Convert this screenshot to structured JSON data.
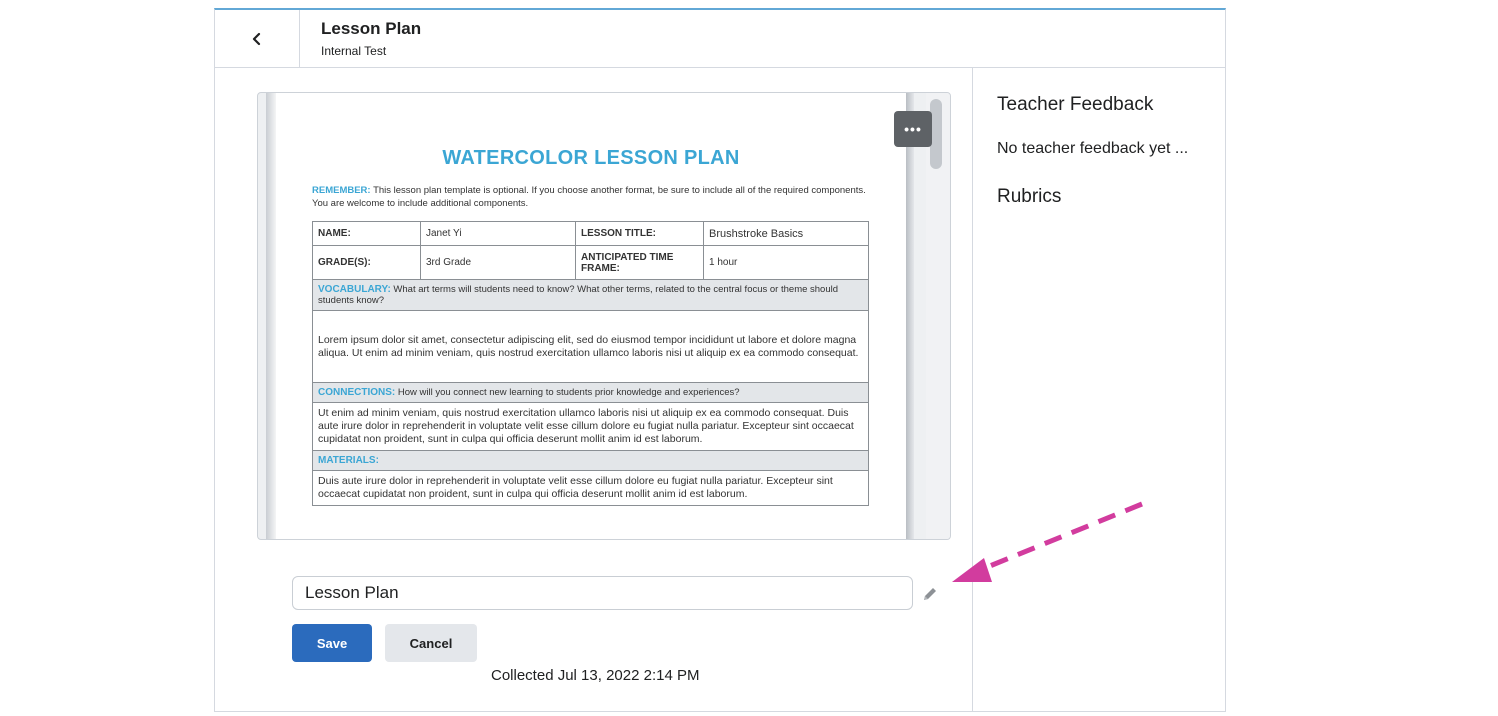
{
  "header": {
    "title": "Lesson Plan",
    "subtitle": "Internal Test"
  },
  "side_panel": {
    "feedback_heading": "Teacher Feedback",
    "feedback_text": "No teacher feedback yet ...",
    "rubrics_heading": "Rubrics"
  },
  "document": {
    "title": "WATERCOLOR LESSON PLAN",
    "remember_label": "REMEMBER:",
    "remember_text": "This lesson plan template is optional. If you choose another format, be sure to include all of the required components. You are welcome to include additional components.",
    "fields": {
      "name_label": "NAME:",
      "name_value": "Janet Yi",
      "lesson_title_label": "LESSON TITLE:",
      "lesson_title_value": "Brushstroke Basics",
      "grade_label": "GRADE(S):",
      "grade_value": "3rd Grade",
      "time_label": "ANTICIPATED TIME FRAME:",
      "time_value": "1 hour"
    },
    "vocabulary_label": "VOCABULARY:",
    "vocabulary_prompt": "What art terms will students need to know? What other terms, related to the central focus or theme should students know?",
    "vocabulary_body": "Lorem ipsum dolor sit amet, consectetur adipiscing elit, sed do eiusmod tempor incididunt ut labore et dolore magna aliqua. Ut enim ad minim veniam, quis nostrud exercitation ullamco laboris nisi ut aliquip ex ea commodo consequat.",
    "connections_label": "CONNECTIONS:",
    "connections_prompt": "How will you connect new learning to students prior knowledge and experiences?",
    "connections_body": "Ut enim ad minim veniam, quis nostrud exercitation ullamco laboris nisi ut aliquip ex ea commodo consequat. Duis aute irure dolor in reprehenderit in voluptate velit esse cillum dolore eu fugiat nulla pariatur. Excepteur sint occaecat cupidatat non proident, sunt in culpa qui officia deserunt mollit anim id est laborum.",
    "materials_label": "MATERIALS:",
    "materials_body": "Duis aute irure dolor in reprehenderit in voluptate velit esse cillum dolore eu fugiat nulla pariatur. Excepteur sint occaecat cupidatat non proident, sunt in culpa qui officia deserunt mollit anim id est laborum.",
    "more_button": "•••"
  },
  "form": {
    "name_value": "Lesson Plan",
    "save_label": "Save",
    "cancel_label": "Cancel",
    "collected_text": "Collected Jul 13, 2022 2:14 PM"
  },
  "colors": {
    "accent": "#3ba6d4",
    "primary_button": "#2b6bbd",
    "annotation_arrow": "#d23c9e"
  },
  "icons": [
    "chevron-left-icon",
    "more-options-icon",
    "pencil-icon"
  ]
}
